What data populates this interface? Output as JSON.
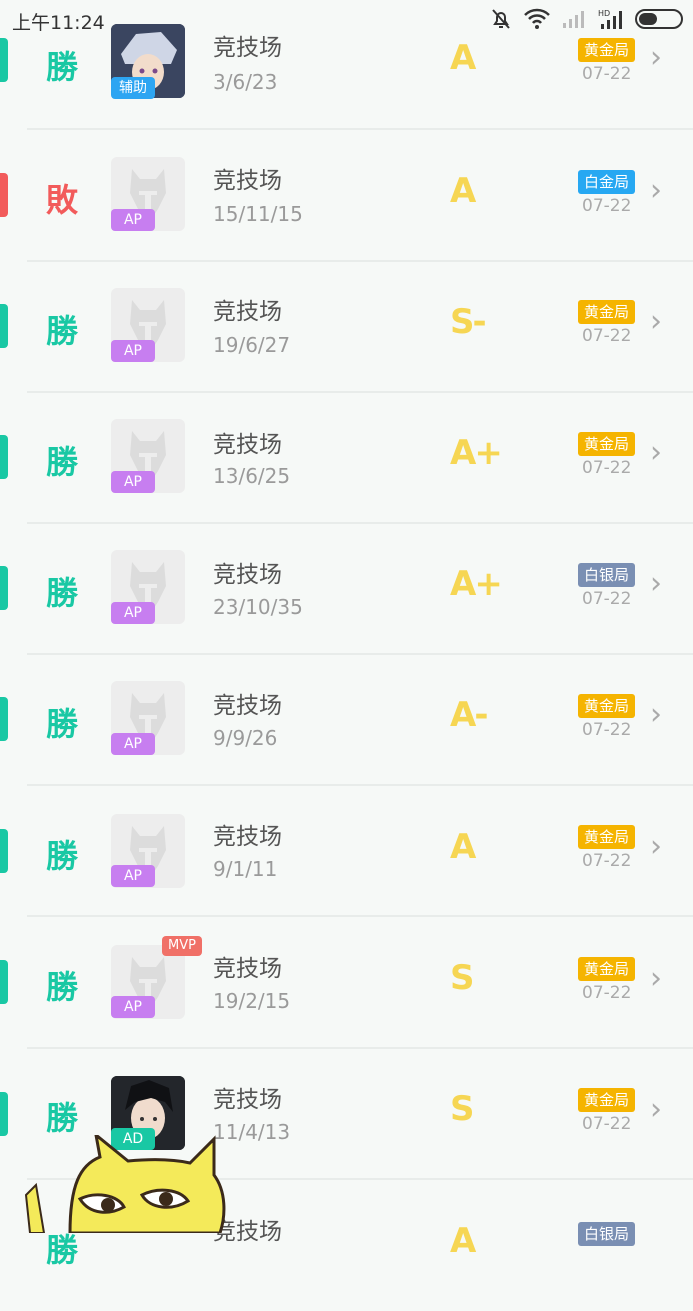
{
  "status_bar": {
    "time": "上午11:24"
  },
  "colors": {
    "win": "#19c8a4",
    "loss": "#f25b5b",
    "grade": "#f6d653",
    "gold": "#f5b400",
    "platinum": "#27a8f2",
    "silver": "#7a8fb3",
    "ap": "#c77ef0",
    "support": "#2da5f2",
    "ad": "#19c8a4"
  },
  "rows": [
    {
      "result": "勝",
      "role": "辅助",
      "mode": "竞技场",
      "kda": "3/6/23",
      "grade": "A",
      "tier": "黄金局",
      "date": "07-22"
    },
    {
      "result": "敗",
      "role": "AP",
      "mode": "竞技场",
      "kda": "15/11/15",
      "grade": "A",
      "tier": "白金局",
      "date": "07-22"
    },
    {
      "result": "勝",
      "role": "AP",
      "mode": "竞技场",
      "kda": "19/6/27",
      "grade": "S-",
      "tier": "黄金局",
      "date": "07-22"
    },
    {
      "result": "勝",
      "role": "AP",
      "mode": "竞技场",
      "kda": "13/6/25",
      "grade": "A+",
      "tier": "黄金局",
      "date": "07-22"
    },
    {
      "result": "勝",
      "role": "AP",
      "mode": "竞技场",
      "kda": "23/10/35",
      "grade": "A+",
      "tier": "白银局",
      "date": "07-22"
    },
    {
      "result": "勝",
      "role": "AP",
      "mode": "竞技场",
      "kda": "9/9/26",
      "grade": "A-",
      "tier": "黄金局",
      "date": "07-22"
    },
    {
      "result": "勝",
      "role": "AP",
      "mode": "竞技场",
      "kda": "9/1/11",
      "grade": "A",
      "tier": "黄金局",
      "date": "07-22"
    },
    {
      "result": "勝",
      "role": "AP",
      "mvp": "MVP",
      "mode": "竞技场",
      "kda": "19/2/15",
      "grade": "S",
      "tier": "黄金局",
      "date": "07-22"
    },
    {
      "result": "勝",
      "role": "AD",
      "mode": "竞技场",
      "kda": "11/4/13",
      "grade": "S",
      "tier": "黄金局",
      "date": "07-22"
    },
    {
      "result": "勝",
      "role": "",
      "mode": "竞技场",
      "kda": "",
      "grade": "A",
      "tier": "白银局",
      "date": ""
    }
  ]
}
